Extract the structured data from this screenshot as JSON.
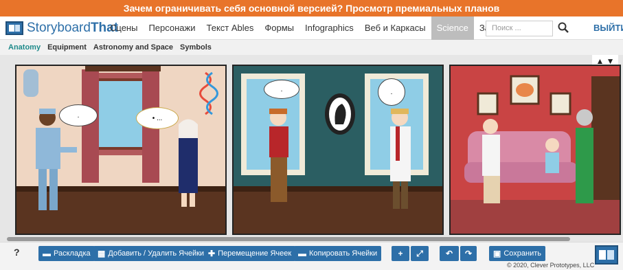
{
  "promo": {
    "text": "Зачем ограничивать себя основной версией? Просмотр премиальных планов"
  },
  "logo": {
    "part1": "Storyboard",
    "part2": "That"
  },
  "nav": {
    "items": [
      {
        "label": "Сцены"
      },
      {
        "label": "Персонажи"
      },
      {
        "label": "Текст Ables"
      },
      {
        "label": "Формы"
      },
      {
        "label": "Infographics"
      },
      {
        "label": "Веб и Каркасы"
      },
      {
        "label": "Science"
      },
      {
        "label": "Загрузить"
      }
    ],
    "search_placeholder": "Поиск ...",
    "exit_label": "ВЫЙТИ"
  },
  "subnav": {
    "items": [
      {
        "label": "Anatomy"
      },
      {
        "label": "Equipment"
      },
      {
        "label": "Astronomy and Space"
      },
      {
        "label": "Symbols"
      }
    ]
  },
  "canvas": {
    "updown": "▲ ▼"
  },
  "cells": [
    {
      "bubble1": ".",
      "bubble2": "• ..."
    },
    {
      "bubble1": ".",
      "bubble2": "."
    },
    {}
  ],
  "toolbar": {
    "help": "?",
    "layout": "Раскладка",
    "add_remove": "Добавить / Удалить Ячейки",
    "move": "Перемещение Ячеек",
    "copy": "Копировать Ячейки",
    "save": "Сохранить",
    "copyright": "© 2020, Clever Prototypes, LLC"
  },
  "colors": {
    "accent": "#2d6fa8",
    "promo": "#e8742a"
  }
}
